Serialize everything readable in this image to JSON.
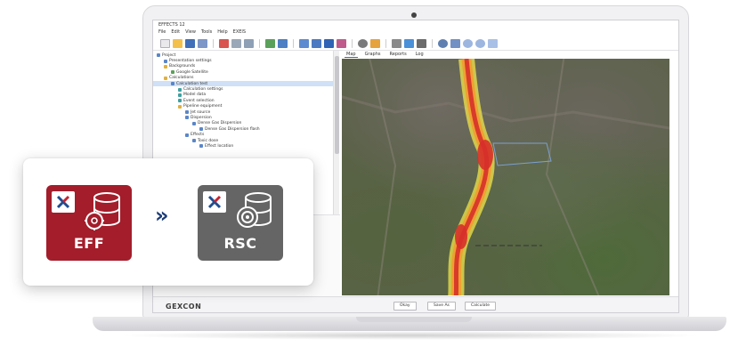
{
  "app": {
    "window_title": "EFFECTS 12",
    "menu": [
      "File",
      "Edit",
      "View",
      "Tools",
      "Help",
      "EXEIS"
    ],
    "tree_items": [
      "Project",
      "Presentation settings",
      "Backgrounds",
      "Google Satellite",
      "Calculations",
      "Calculation test",
      "Calculation settings",
      "Model data",
      "Event selection",
      "Pipeline equipment",
      "Jet source",
      "Dispersion",
      "Dense Gas Dispersion",
      "Dense Gas Dispersion flash",
      "Effects",
      "Toxic dose",
      "Effect location"
    ],
    "map_tabs": [
      "Map",
      "Graphs",
      "Reports",
      "Log"
    ],
    "active_map_tab": "Map",
    "brand": "GEXCON",
    "status_buttons": [
      "Okay",
      "Save As",
      "Calculate"
    ]
  },
  "card": {
    "from_label": "EFF",
    "to_label": "RSC",
    "arrow": "»"
  },
  "colors": {
    "eff": "#a31d2b",
    "rsc": "#656565",
    "arrow": "#1b3b78",
    "x_blue": "#1f4d8f",
    "x_red": "#c62330"
  },
  "icons": {
    "eff_badge": "x-logo-icon",
    "eff_glyph": "database-gear-icon",
    "rsc_badge": "x-logo-icon",
    "rsc_glyph": "database-ring-icon"
  }
}
